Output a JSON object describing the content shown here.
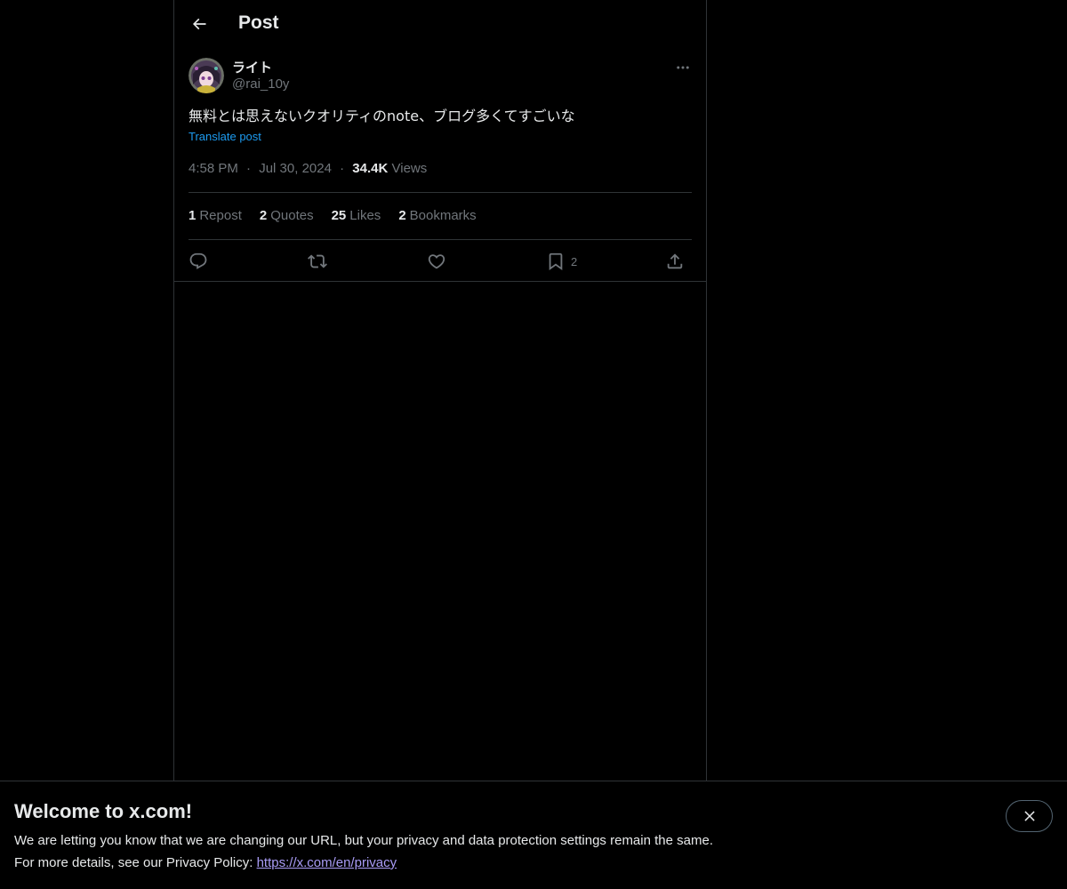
{
  "header": {
    "title": "Post"
  },
  "author": {
    "display_name": "ライト",
    "handle": "@rai_10y"
  },
  "post": {
    "text": "無料とは思えないクオリティのnote、ブログ多くてすごいな",
    "translate_label": "Translate post",
    "time": "4:58 PM",
    "date": "Jul 30, 2024",
    "views_count": "34.4K",
    "views_label": "Views",
    "separator": "·"
  },
  "stats": {
    "reposts_count": "1",
    "reposts_label": "Repost",
    "quotes_count": "2",
    "quotes_label": "Quotes",
    "likes_count": "25",
    "likes_label": "Likes",
    "bookmarks_count": "2",
    "bookmarks_label": "Bookmarks"
  },
  "actions": {
    "reply_icon": "reply-icon",
    "repost_icon": "repost-icon",
    "like_icon": "heart-icon",
    "bookmark_icon": "bookmark-icon",
    "bookmark_count": "2",
    "share_icon": "share-icon"
  },
  "banner": {
    "title": "Welcome to x.com!",
    "line1": "We are letting you know that we are changing our URL, but your privacy and data protection settings remain the same.",
    "line2_prefix": "For more details, see our Privacy Policy: ",
    "link": "https://x.com/en/privacy"
  },
  "colors": {
    "background": "#000000",
    "text": "#e7e9ea",
    "muted": "#71767b",
    "accent": "#1d9bf0",
    "link": "#a99cf6",
    "border": "#2f3336"
  }
}
